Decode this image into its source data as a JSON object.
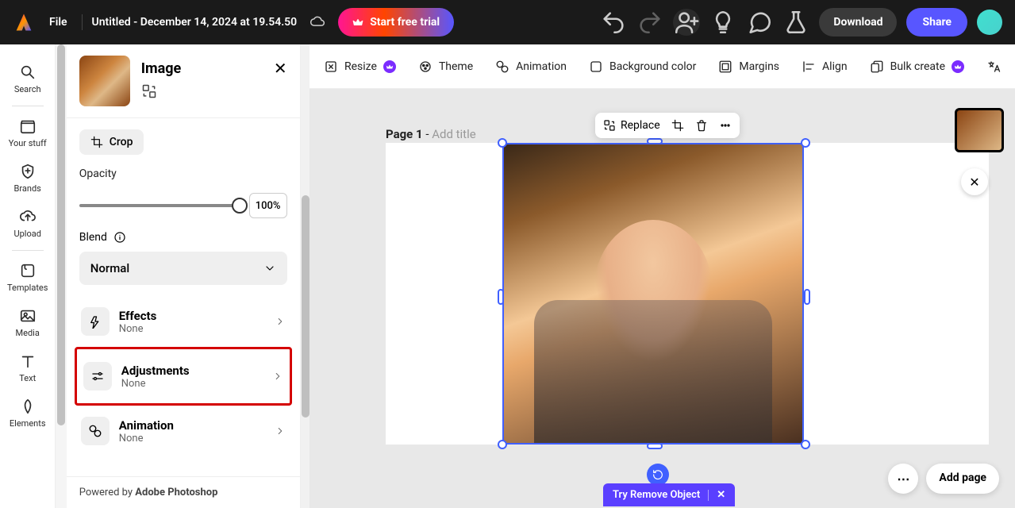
{
  "topbar": {
    "file_label": "File",
    "title": "Untitled - December 14, 2024 at 19.54.50",
    "trial_label": "Start free trial",
    "download_label": "Download",
    "share_label": "Share"
  },
  "leftrail": {
    "search": "Search",
    "your_stuff": "Your stuff",
    "brands": "Brands",
    "upload": "Upload",
    "templates": "Templates",
    "media": "Media",
    "text": "Text",
    "elements": "Elements"
  },
  "panel": {
    "title": "Image",
    "crop": "Crop",
    "opacity_label": "Opacity",
    "opacity_value": "100%",
    "blend_label": "Blend",
    "blend_value": "Normal",
    "sections": {
      "effects": {
        "title": "Effects",
        "sub": "None"
      },
      "adjustments": {
        "title": "Adjustments",
        "sub": "None"
      },
      "animation": {
        "title": "Animation",
        "sub": "None"
      }
    },
    "footer_prefix": "Powered by ",
    "footer_brand": "Adobe Photoshop"
  },
  "toolbar": {
    "resize": "Resize",
    "theme": "Theme",
    "animation": "Animation",
    "background": "Background color",
    "margins": "Margins",
    "align": "Align",
    "bulk": "Bulk create"
  },
  "canvas": {
    "page_label": "Page 1",
    "dash": " - ",
    "add_title": "Add title",
    "float_replace": "Replace",
    "try_remove": "Try Remove Object",
    "add_page": "Add page"
  }
}
